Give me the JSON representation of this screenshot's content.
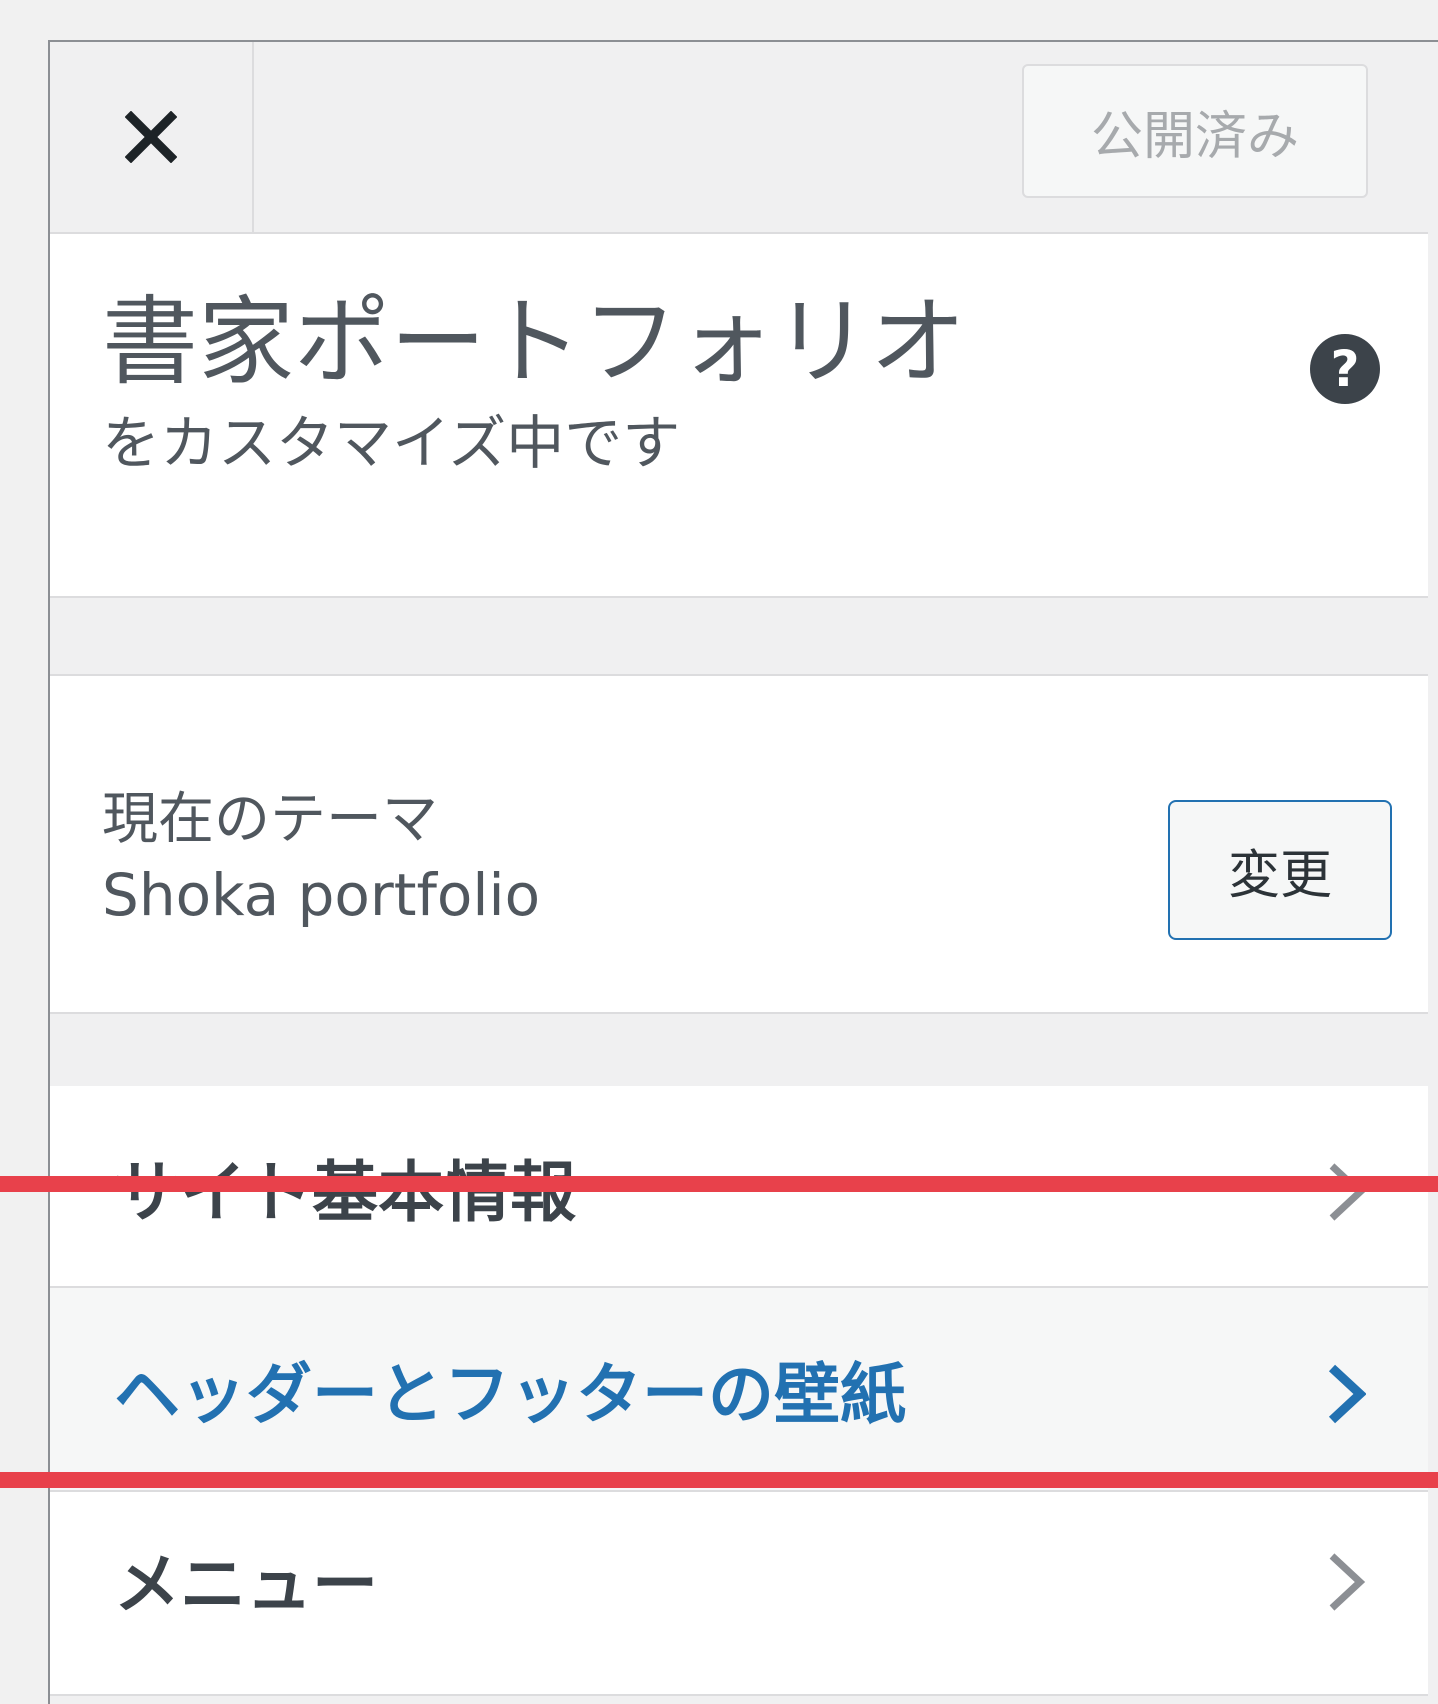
{
  "header": {
    "close_label": "×",
    "publish_label": "公開済み"
  },
  "title": {
    "site_name": "書家ポートフォリオ",
    "subtitle": "をカスタマイズ中です"
  },
  "theme": {
    "label": "現在のテーマ",
    "name": "Shoka portfolio",
    "change_label": "変更"
  },
  "menu": {
    "items": [
      {
        "label": "サイト基本情報",
        "state": "normal"
      },
      {
        "label": "ヘッダーとフッターの壁紙",
        "state": "hover"
      },
      {
        "label": "メニュー",
        "state": "normal"
      }
    ]
  },
  "colors": {
    "accent": "#2271b1",
    "highlight": "#e8414b",
    "text": "#3c434a"
  }
}
